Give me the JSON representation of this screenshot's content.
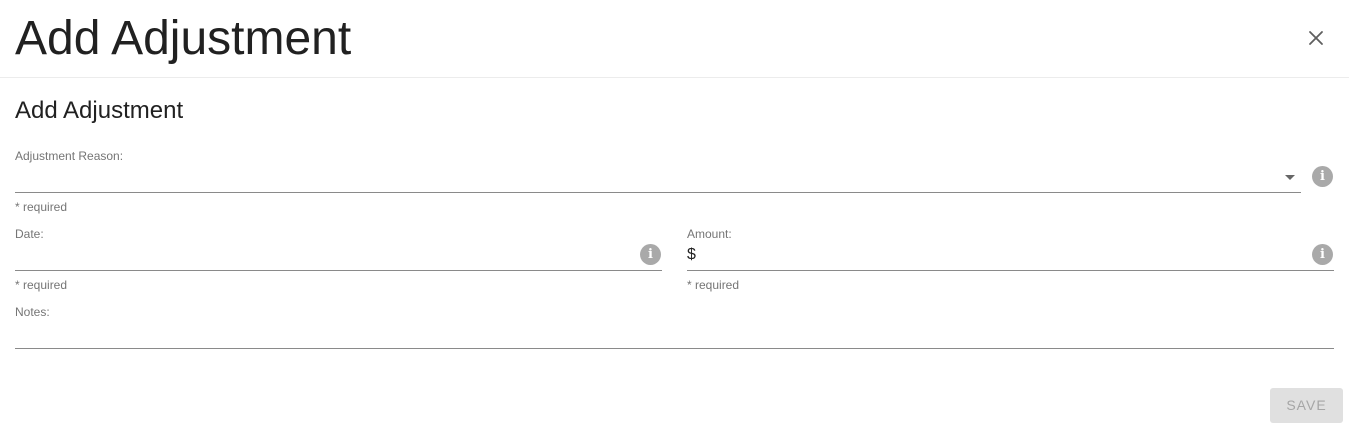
{
  "header": {
    "title": "Add Adjustment",
    "close_icon": "close-icon"
  },
  "form": {
    "section_title": "Add Adjustment",
    "adjustment_reason": {
      "label": "Adjustment Reason:",
      "value": "",
      "hint": "* required",
      "icon": "info-icon"
    },
    "date": {
      "label": "Date:",
      "value": "",
      "hint": "* required",
      "icon": "info-icon"
    },
    "amount": {
      "label": "Amount:",
      "prefix": "$",
      "value": "",
      "hint": "* required",
      "icon": "info-icon"
    },
    "notes": {
      "label": "Notes:",
      "value": ""
    }
  },
  "actions": {
    "save_label": "SAVE",
    "save_disabled": true
  },
  "colors": {
    "disabled_button_bg": "#e0e0e0",
    "disabled_button_text": "#a6a6a6",
    "info_icon": "#a9a9a9",
    "label": "#757575"
  }
}
